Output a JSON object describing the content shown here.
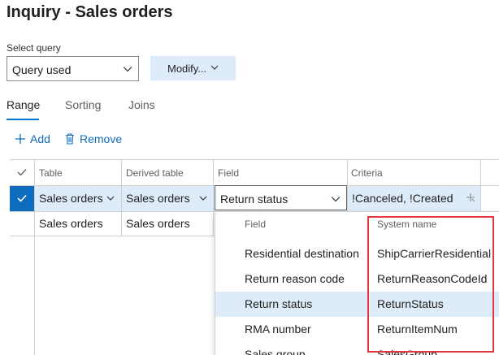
{
  "page": {
    "title": "Inquiry - Sales orders"
  },
  "query": {
    "label": "Select query",
    "value": "Query used",
    "modify_label": "Modify..."
  },
  "tabs": [
    {
      "label": "Range"
    },
    {
      "label": "Sorting"
    },
    {
      "label": "Joins"
    }
  ],
  "actions": {
    "add_label": "Add",
    "remove_label": "Remove"
  },
  "grid": {
    "headers": [
      "Table",
      "Derived table",
      "Field",
      "Criteria"
    ],
    "rows": [
      {
        "table": "Sales orders",
        "derived": "Sales orders",
        "field": "Return status",
        "criteria": "!Canceled, !Created",
        "selected": true
      },
      {
        "table": "Sales orders",
        "derived": "Sales orders",
        "field": "",
        "criteria": "",
        "selected": false
      }
    ]
  },
  "field_dropdown": {
    "headers": {
      "field": "Field",
      "system_name": "System name"
    },
    "items": [
      {
        "field": "Residential destination",
        "system_name": "ShipCarrierResidential"
      },
      {
        "field": "Return reason code",
        "system_name": "ReturnReasonCodeId"
      },
      {
        "field": "Return status",
        "system_name": "ReturnStatus",
        "selected": true
      },
      {
        "field": "RMA number",
        "system_name": "ReturnItemNum"
      },
      {
        "field": "Sales group",
        "system_name": "SalesGroup"
      }
    ]
  },
  "colors": {
    "accent": "#0f6cbd",
    "selection": "#deecf9",
    "highlight_box": "#e2373f"
  }
}
